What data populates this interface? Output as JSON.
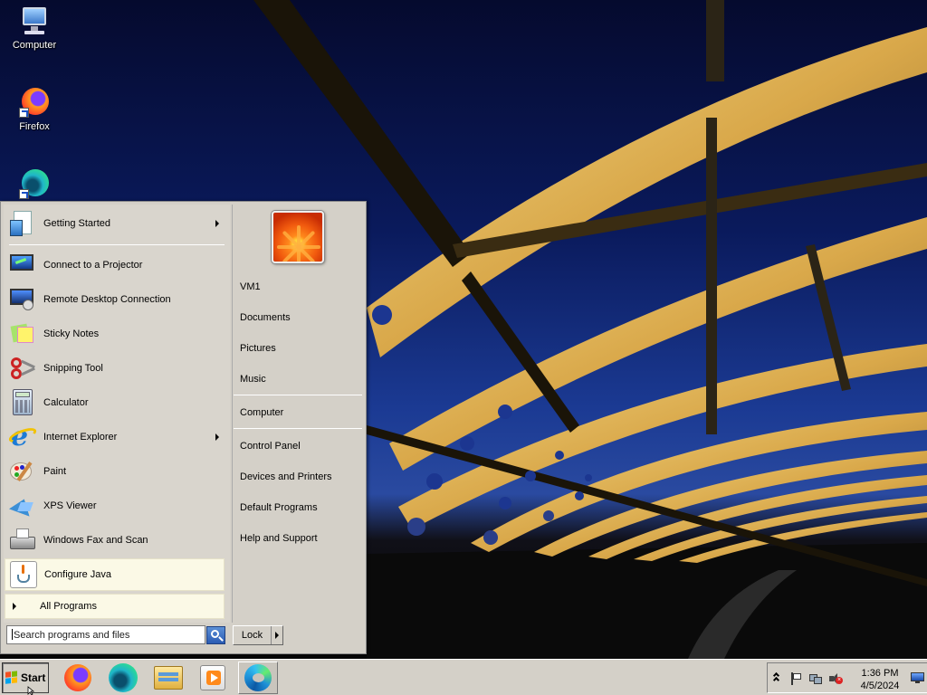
{
  "desktop": {
    "icons": [
      {
        "label": "Computer",
        "icon": "computer-icon"
      },
      {
        "label": "Firefox",
        "icon": "firefox-icon"
      },
      {
        "label": "",
        "icon": "edge-shortcut-icon"
      }
    ]
  },
  "start_menu": {
    "programs": [
      {
        "label": "Getting Started",
        "icon": "getting-started-icon",
        "submenu": true
      },
      {
        "label": "Connect to a Projector",
        "icon": "projector-icon",
        "submenu": false
      },
      {
        "label": "Remote Desktop Connection",
        "icon": "remote-desktop-icon",
        "submenu": false
      },
      {
        "label": "Sticky Notes",
        "icon": "sticky-notes-icon",
        "submenu": false
      },
      {
        "label": "Snipping Tool",
        "icon": "scissors-icon",
        "submenu": false
      },
      {
        "label": "Calculator",
        "icon": "calculator-icon",
        "submenu": false
      },
      {
        "label": "Internet Explorer",
        "icon": "ie-icon",
        "submenu": true
      },
      {
        "label": "Paint",
        "icon": "paint-palette-icon",
        "submenu": false
      },
      {
        "label": "XPS Viewer",
        "icon": "xps-viewer-icon",
        "submenu": false
      },
      {
        "label": "Windows Fax and Scan",
        "icon": "fax-icon",
        "submenu": false
      },
      {
        "label": "Configure Java",
        "icon": "java-icon",
        "submenu": false,
        "highlighted": true
      }
    ],
    "all_programs_label": "All Programs",
    "right_links": {
      "user": "VM1",
      "documents": "Documents",
      "pictures": "Pictures",
      "music": "Music",
      "computer": "Computer",
      "control_panel": "Control Panel",
      "devices_printers": "Devices and Printers",
      "default_programs": "Default Programs",
      "help_support": "Help and Support"
    },
    "search_placeholder": "Search programs and files",
    "lock_label": "Lock"
  },
  "taskbar": {
    "start_label": "Start",
    "pinned": [
      {
        "name": "firefox",
        "icon": "firefox-icon"
      },
      {
        "name": "edge-beta",
        "icon": "edge-beta-icon"
      },
      {
        "name": "explorer",
        "icon": "folder-icon"
      },
      {
        "name": "media-player",
        "icon": "media-player-icon"
      },
      {
        "name": "edge",
        "icon": "edge-icon",
        "active": true
      }
    ],
    "tray": {
      "time": "1:36 PM",
      "date": "4/5/2024"
    }
  },
  "colors": {
    "menu_bg": "#d4d0c8",
    "highlight": "#fbf9e6",
    "wallpaper_sky": "#0a1a5c",
    "bridge_gold": "#e8c36a"
  }
}
